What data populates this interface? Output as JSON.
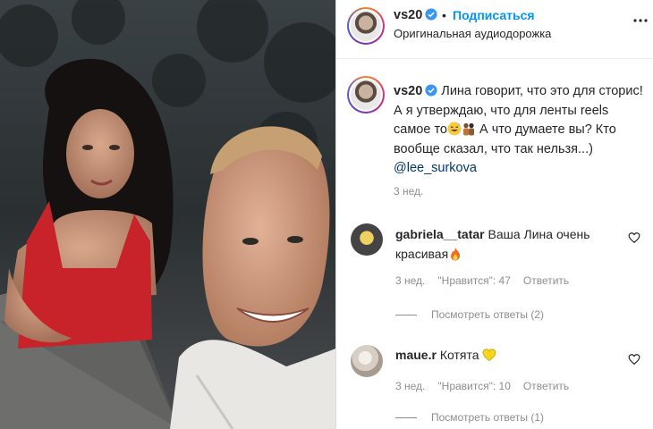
{
  "post": {
    "username": "vs20",
    "follow_label": "Подписаться",
    "separator": "•",
    "audio_label": "Оригинальная аудиодорожка",
    "caption_text": "Лина говорит, что это для сторис! А я утверждаю, что для ленты reels самое то",
    "caption_text2": "А что думаете вы? Кто вообще сказал, что так нельзя...)",
    "caption_mention": "@lee_surkova",
    "caption_time": "3 нед."
  },
  "comments": [
    {
      "username": "gabriela__tatar",
      "text": "Ваша Лина очень красивая",
      "time": "3 нед.",
      "likes": "\"Нравится\": 47",
      "reply_label": "Ответить",
      "view_replies": "Посмотреть ответы (2)"
    },
    {
      "username": "maue.r",
      "text": "Котята",
      "time": "3 нед.",
      "likes": "\"Нравится\": 10",
      "reply_label": "Ответить",
      "view_replies": "Посмотреть ответы (1)"
    }
  ],
  "colors": {
    "link_blue": "#0095f6",
    "mention": "#00376b",
    "secondary": "#8e8e8e",
    "verified": "#3897f0"
  },
  "icons": [
    "verified-badge-icon",
    "more-options-icon",
    "heart-icon",
    "grinning-sweat-emoji",
    "couple-emoji",
    "fire-emoji",
    "yellow-heart-emoji"
  ]
}
